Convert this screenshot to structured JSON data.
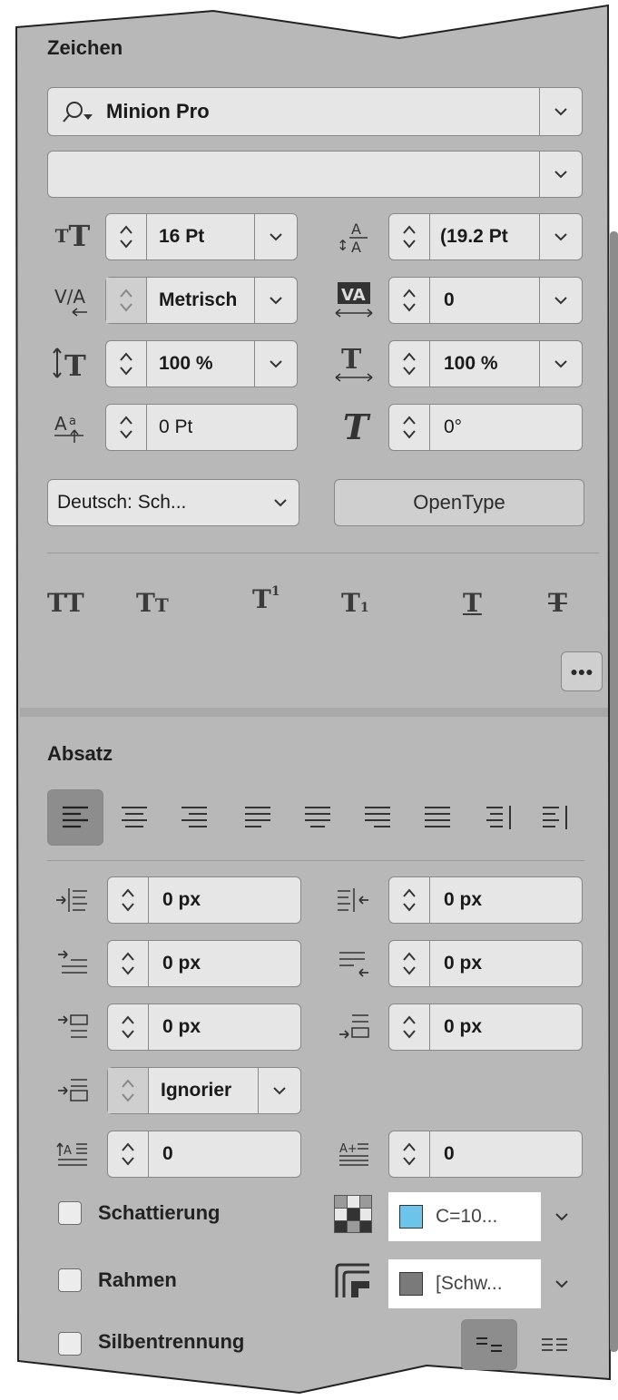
{
  "zeichen": {
    "title": "Zeichen",
    "font_family": "Minion Pro",
    "font_style": "",
    "font_size": "16 Pt",
    "leading": "(19.2 Pt",
    "kerning": "Metrisch",
    "tracking": "0",
    "vertical_scale": "100 %",
    "horizontal_scale": "100 %",
    "baseline_shift": "0 Pt",
    "skew": "0°",
    "language": "Deutsch: Sch...",
    "opentype_label": "OpenType"
  },
  "absatz": {
    "title": "Absatz",
    "left_indent": "0 px",
    "right_indent": "0 px",
    "first_line_indent": "0 px",
    "last_line_indent": "0 px",
    "space_before": "0 px",
    "space_after": "0 px",
    "align_to_grid": "Ignorier",
    "drop_cap_lines": "0",
    "drop_cap_chars": "0",
    "shading_label": "Schattierung",
    "shading_swatch": "C=10...",
    "border_label": "Rahmen",
    "border_swatch": "[Schw...",
    "hyphenation_label": "Silbentrennung"
  },
  "colors": {
    "panel_bg": "#b8b8b8",
    "field_bg": "#e6e6e6",
    "shading_swatch_color": "#6cc4ea",
    "border_swatch_color": "#7a7a7a"
  }
}
